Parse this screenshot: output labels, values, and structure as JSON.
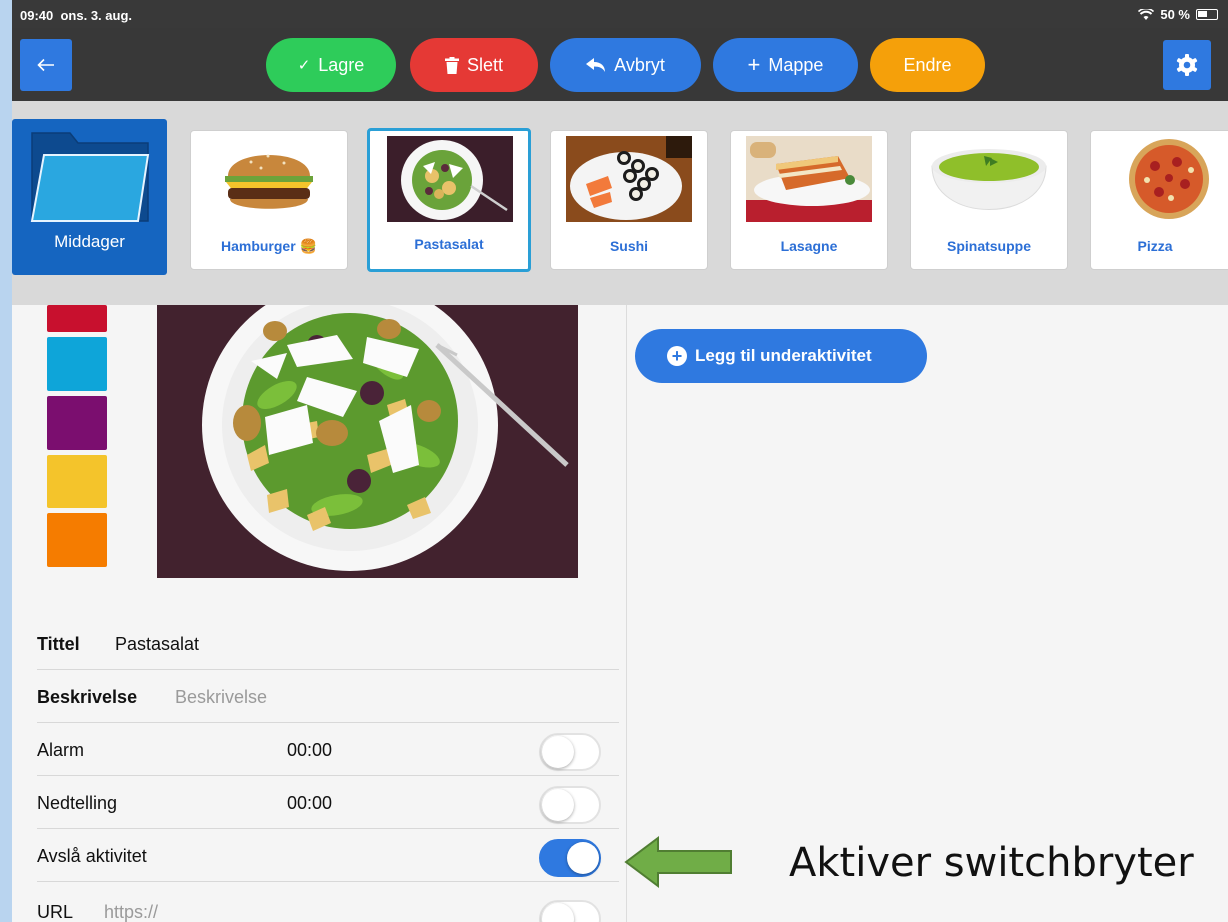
{
  "status_bar": {
    "time": "09:40",
    "date": "ons. 3. aug.",
    "battery": "50 %"
  },
  "toolbar": {
    "save": "Lagre",
    "delete": "Slett",
    "cancel": "Avbryt",
    "folder": "Mappe",
    "edit": "Endre",
    "colors": {
      "save": "#2ecc5a",
      "delete": "#e53935",
      "blue": "#2f79e0",
      "edit": "#f5a00a"
    }
  },
  "shelf": {
    "folder_label": "Middager",
    "items": [
      {
        "label": "Hamburger 🍔"
      },
      {
        "label": "Pastasalat"
      },
      {
        "label": "Sushi"
      },
      {
        "label": "Lasagne"
      },
      {
        "label": "Spinatsuppe"
      },
      {
        "label": "Pizza"
      }
    ]
  },
  "swatches": [
    "#c8102e",
    "#0ea5d9",
    "#7b0e6f",
    "#f4c42b",
    "#f57c00"
  ],
  "form": {
    "title_label": "Tittel",
    "title_value": "Pastasalat",
    "description_label": "Beskrivelse",
    "description_placeholder": "Beskrivelse",
    "alarm_label": "Alarm",
    "alarm_value": "00:00",
    "countdown_label": "Nedtelling",
    "countdown_value": "00:00",
    "disable_label": "Avslå aktivitet",
    "url_label": "URL",
    "url_placeholder": "https://"
  },
  "right_pane": {
    "add_subactivity": "Legg til underaktivitet"
  },
  "callout": {
    "text": "Aktiver switchbryter",
    "arrow_color": "#70ad47"
  }
}
